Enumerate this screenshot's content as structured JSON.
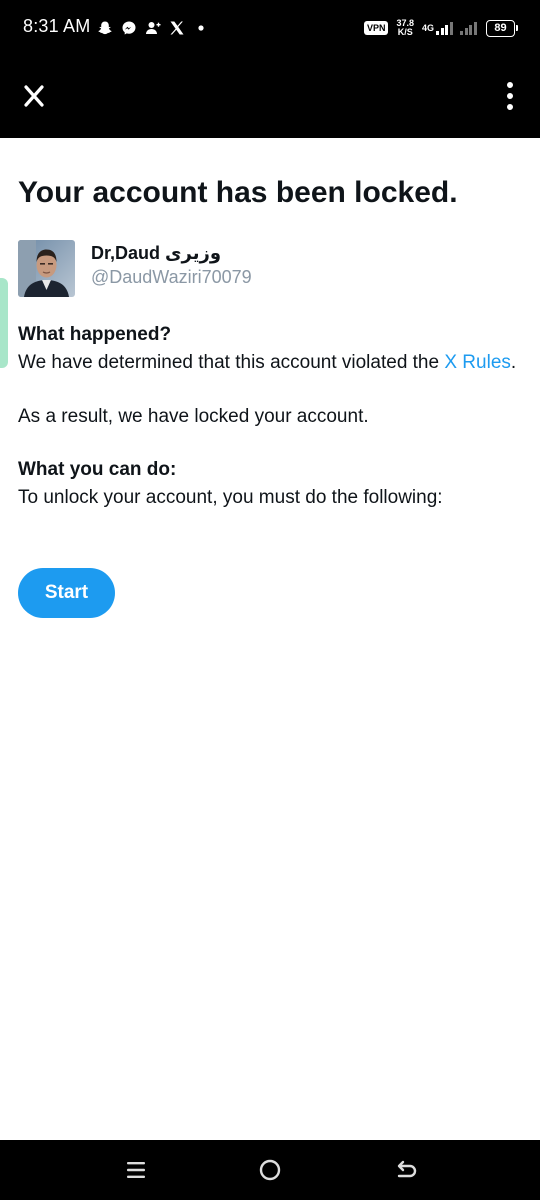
{
  "status_bar": {
    "time": "8:31 AM",
    "left_icons": [
      "snapchat-icon",
      "messenger-icon",
      "person-add-icon",
      "x-logo-icon",
      "dot-icon"
    ],
    "vpn": "VPN",
    "speed_value": "37.8",
    "speed_unit": "K/S",
    "network": "4G",
    "battery": "89"
  },
  "header": {
    "close_icon": "x-logo-icon",
    "menu_icon": "more-vertical-icon"
  },
  "main": {
    "title": "Your account has been locked.",
    "account": {
      "display_name": "Dr,Daud وزیری",
      "handle": "@DaudWaziri70079"
    },
    "what_happened_heading": "What happened?",
    "what_happened_text": "We have determined that this account violated the ",
    "rules_link": "X Rules",
    "what_happened_end": ".",
    "result_text": "As a result, we have locked your account.",
    "what_you_can_do_heading": "What you can do:",
    "what_you_can_do_text": "To unlock your account, you must do the following:",
    "start_button": "Start"
  },
  "colors": {
    "accent": "#1d9bf0",
    "text": "#0f1419",
    "secondary_text": "#8b98a5",
    "bar_background": "#000000"
  },
  "nav_bar": {
    "icons": [
      "recent-apps-icon",
      "home-icon",
      "back-icon"
    ]
  }
}
